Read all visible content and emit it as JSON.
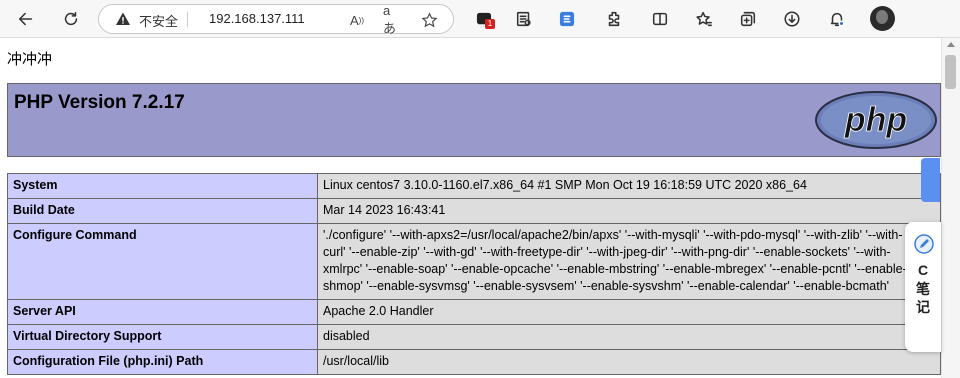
{
  "browser": {
    "address_bar": {
      "security_label": "不安全",
      "url": "192.168.137.111"
    },
    "extension_badge": "1",
    "icons": [
      "back-icon",
      "refresh-icon",
      "warning-icon",
      "read-aloud-icon",
      "translate-icon",
      "favorite-add-icon",
      "extension-icon",
      "reader-icon",
      "translate-extension-icon",
      "extensions-icon",
      "split-screen-icon",
      "favorites-icon",
      "collections-icon",
      "downloads-icon",
      "notifications-icon",
      "profile-avatar"
    ]
  },
  "page": {
    "heading": "冲冲冲",
    "php_title": "PHP Version 7.2.17",
    "php_logo_text": "php",
    "rows": [
      {
        "key": "System",
        "value": "Linux centos7 3.10.0-1160.el7.x86_64 #1 SMP Mon Oct 19 16:18:59 UTC 2020 x86_64"
      },
      {
        "key": "Build Date",
        "value": "Mar 14 2023 16:43:41"
      },
      {
        "key": "Configure Command",
        "value": "'./configure' '--with-apxs2=/usr/local/apache2/bin/apxs' '--with-mysqli' '--with-pdo-mysql' '--with-zlib' '--with-curl' '--enable-zip' '--with-gd' '--with-freetype-dir' '--with-jpeg-dir' '--with-png-dir' '--enable-sockets' '--with-xmlrpc' '--enable-soap' '--enable-opcache' '--enable-mbstring' '--enable-mbregex' '--enable-pcntl' '--enable-shmop' '--enable-sysvmsg' '--enable-sysvsem' '--enable-sysvshm' '--enable-calendar' '--enable-bcmath'"
      },
      {
        "key": "Server API",
        "value": "Apache 2.0 Handler"
      },
      {
        "key": "Virtual Directory Support",
        "value": "disabled"
      },
      {
        "key": "Configuration File (php.ini) Path",
        "value": "/usr/local/lib"
      }
    ]
  },
  "side_widget": {
    "line1": "C",
    "line2": "笔",
    "line3": "记"
  },
  "colors": {
    "php_banner": "#9999cc",
    "key_cell": "#ccccff",
    "value_cell": "#dddddd",
    "side_tab": "#5b8ff0"
  }
}
